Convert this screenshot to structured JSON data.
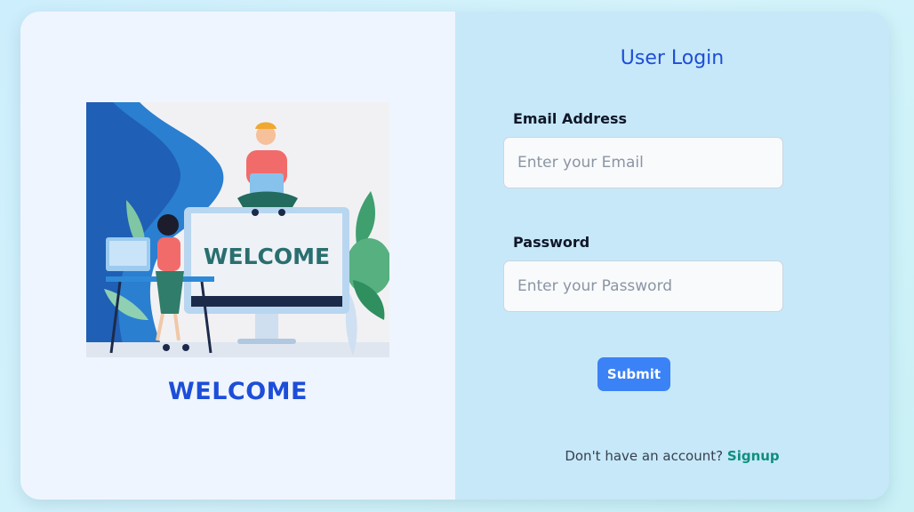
{
  "left_panel": {
    "illustration_text": "WELCOME",
    "heading": "WELCOME"
  },
  "login": {
    "title": "User Login",
    "email_label": "Email Address",
    "email_placeholder": "Enter your Email",
    "email_value": "",
    "password_label": "Password",
    "password_placeholder": "Enter your Password",
    "password_value": "",
    "submit_label": "Submit",
    "signup_prompt": "Don't have an account?",
    "signup_link": "Signup"
  },
  "colors": {
    "accent": "#1d4ed8",
    "button": "#3b82f6",
    "link": "#0f8f7d",
    "left_bg": "#eff5fe",
    "right_bg": "#c7e8f8"
  },
  "icons": [
    "welcome-illustration"
  ]
}
